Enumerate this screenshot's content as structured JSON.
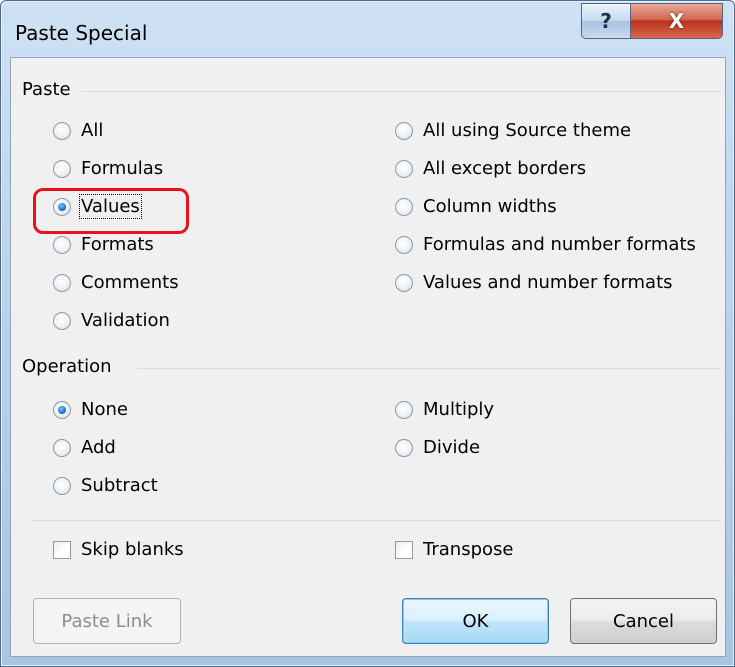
{
  "window": {
    "title": "Paste Special",
    "help_glyph": "?",
    "close_glyph": "X"
  },
  "paste": {
    "label": "Paste",
    "left": [
      {
        "label": "All",
        "selected": false
      },
      {
        "label": "Formulas",
        "selected": false
      },
      {
        "label": "Values",
        "selected": true
      },
      {
        "label": "Formats",
        "selected": false
      },
      {
        "label": "Comments",
        "selected": false
      },
      {
        "label": "Validation",
        "selected": false
      }
    ],
    "right": [
      {
        "label": "All using Source theme",
        "selected": false
      },
      {
        "label": "All except borders",
        "selected": false
      },
      {
        "label": "Column widths",
        "selected": false
      },
      {
        "label": "Formulas and number formats",
        "selected": false
      },
      {
        "label": "Values and number formats",
        "selected": false
      }
    ]
  },
  "operation": {
    "label": "Operation",
    "left": [
      {
        "label": "None",
        "selected": true
      },
      {
        "label": "Add",
        "selected": false
      },
      {
        "label": "Subtract",
        "selected": false
      }
    ],
    "right": [
      {
        "label": "Multiply",
        "selected": false
      },
      {
        "label": "Divide",
        "selected": false
      }
    ]
  },
  "options": {
    "skip_blanks": {
      "label": "Skip blanks",
      "checked": false
    },
    "transpose": {
      "label": "Transpose",
      "checked": false
    }
  },
  "buttons": {
    "paste_link": "Paste Link",
    "ok": "OK",
    "cancel": "Cancel"
  },
  "colors": {
    "highlight": "#e8121b",
    "selected_radio": "#1b6fd1"
  }
}
